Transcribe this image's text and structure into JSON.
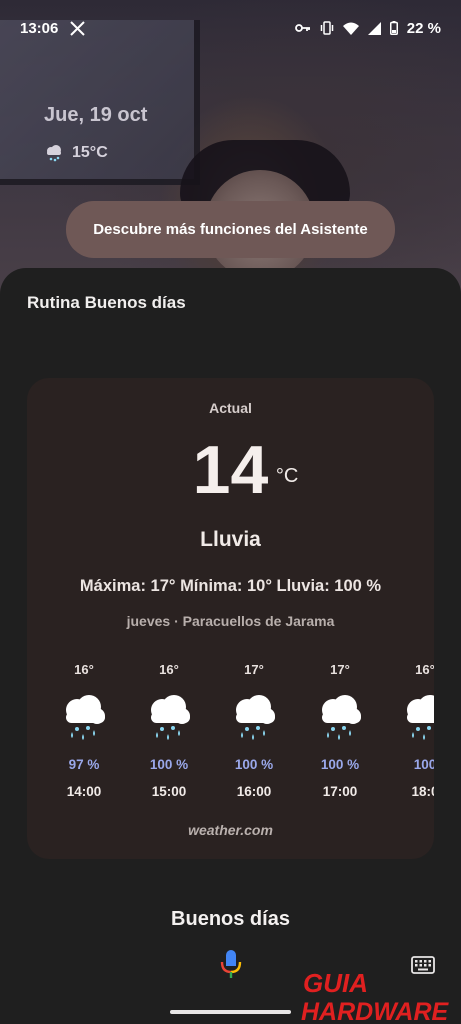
{
  "status_bar": {
    "time": "13:06",
    "battery": "22 %"
  },
  "lockscreen": {
    "date": "Jue, 19 oct",
    "temperature": "15°C"
  },
  "assistant_chip": "Descubre más funciones del Asistente",
  "routine": {
    "title": "Rutina Buenos días",
    "weather": {
      "label": "Actual",
      "temp": "14",
      "unit": "°C",
      "condition": "Lluvia",
      "summary": "Máxima: 17° Mínima: 10° Lluvia: 100 %",
      "location": "jueves · Paracuellos de Jarama",
      "hourly": [
        {
          "temp": "16°",
          "precip": "97 %",
          "time": "14:00"
        },
        {
          "temp": "16°",
          "precip": "100 %",
          "time": "15:00"
        },
        {
          "temp": "17°",
          "precip": "100 %",
          "time": "16:00"
        },
        {
          "temp": "17°",
          "precip": "100 %",
          "time": "17:00"
        },
        {
          "temp": "16°",
          "precip": "100",
          "time": "18:0"
        }
      ],
      "source": "weather.com"
    },
    "greeting": "Buenos días"
  },
  "watermark": {
    "line1": "GUIA",
    "line2": "HARDWARE"
  },
  "colors": {
    "accent_rain": "#8ad6f0",
    "precip_text": "#9aa8ea",
    "chip": "#6f5856",
    "card": "#2a2221",
    "logo_red": "#e02020"
  }
}
